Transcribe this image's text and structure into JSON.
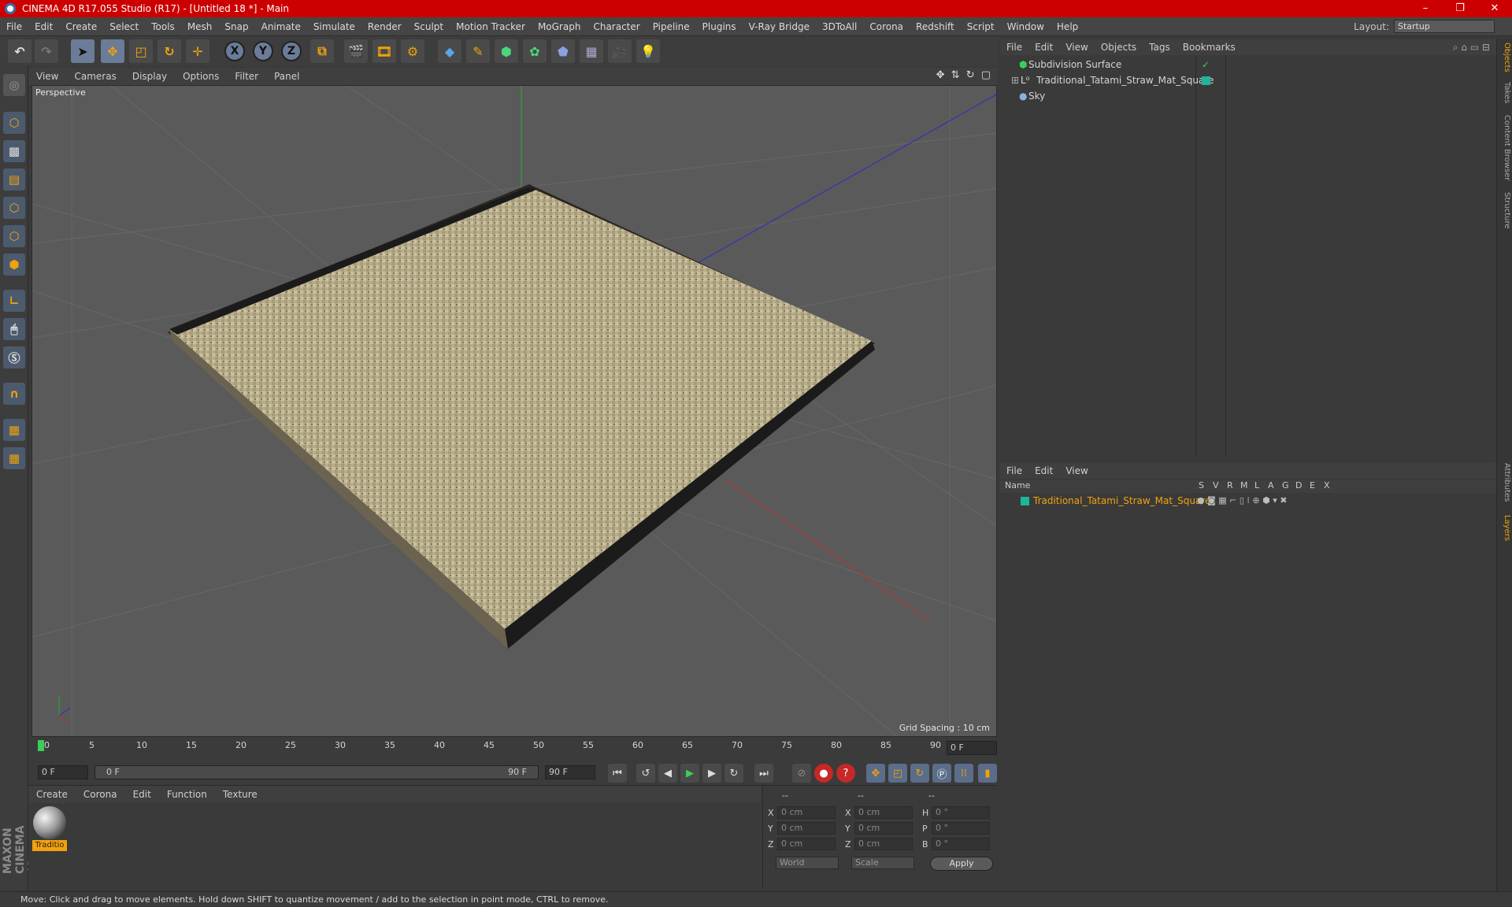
{
  "window": {
    "title": "CINEMA 4D R17.055 Studio (R17) - [Untitled 18 *] - Main",
    "controls": [
      "–",
      "❐",
      "✕"
    ]
  },
  "menubar": {
    "items": [
      "File",
      "Edit",
      "Create",
      "Select",
      "Tools",
      "Mesh",
      "Snap",
      "Animate",
      "Simulate",
      "Render",
      "Sculpt",
      "Motion Tracker",
      "MoGraph",
      "Character",
      "Pipeline",
      "Plugins",
      "V-Ray Bridge",
      "3DToAll",
      "Corona",
      "Redshift",
      "Script",
      "Window",
      "Help"
    ],
    "layout_label": "Layout:",
    "layout_value": "Startup"
  },
  "toolbar": {
    "axis_x": "X",
    "axis_y": "Y",
    "axis_z": "Z"
  },
  "viewport": {
    "menu": [
      "View",
      "Cameras",
      "Display",
      "Options",
      "Filter",
      "Panel"
    ],
    "label": "Perspective",
    "grid_spacing": "Grid Spacing : 10 cm",
    "nav_icons": "✥ ⇅ ↻ ▢"
  },
  "timeline": {
    "ticks": [
      "0",
      "5",
      "10",
      "15",
      "20",
      "25",
      "30",
      "35",
      "40",
      "45",
      "50",
      "55",
      "60",
      "65",
      "70",
      "75",
      "80",
      "85",
      "90"
    ],
    "current_frame": "0 F"
  },
  "transport": {
    "start_field": "0 F",
    "range_start": "0 F",
    "range_end": "90 F",
    "end_field": "90 F"
  },
  "material_manager": {
    "menu": [
      "Create",
      "Corona",
      "Edit",
      "Function",
      "Texture"
    ],
    "material_label": "Traditio"
  },
  "coordinates": {
    "header": [
      "--",
      "--",
      "--"
    ],
    "rows": [
      {
        "l1": "X",
        "v1": "0 cm",
        "l2": "X",
        "v2": "0 cm",
        "l3": "H",
        "v3": "0 °"
      },
      {
        "l1": "Y",
        "v1": "0 cm",
        "l2": "Y",
        "v2": "0 cm",
        "l3": "P",
        "v3": "0 °"
      },
      {
        "l1": "Z",
        "v1": "0 cm",
        "l2": "Z",
        "v2": "0 cm",
        "l3": "B",
        "v3": "0 °"
      }
    ],
    "world": "World",
    "scale": "Scale",
    "apply": "Apply"
  },
  "object_manager": {
    "menu": [
      "File",
      "Edit",
      "View",
      "Objects",
      "Tags",
      "Bookmarks"
    ],
    "objects": [
      "Subdivision Surface",
      "Traditional_Tatami_Straw_Mat_Square",
      "Sky"
    ]
  },
  "layer_manager": {
    "menu": [
      "File",
      "Edit",
      "View"
    ],
    "columns": [
      "Name",
      "S",
      "V",
      "R",
      "M",
      "L",
      "A",
      "G",
      "D",
      "E",
      "X"
    ],
    "layers": [
      "Traditional_Tatami_Straw_Mat_Square"
    ]
  },
  "side_tabs": [
    "Objects",
    "Takes",
    "Content Browser",
    "Structure",
    "Attributes",
    "Layers"
  ],
  "status": "Move: Click and drag to move elements. Hold down SHIFT to quantize movement / add to the selection in point mode, CTRL to remove.",
  "brand": "MAXON CINEMA 4D",
  "colors": {
    "titlebar": "#cc0000",
    "accent": "#f2a20c",
    "layer_color": "#1fb59a",
    "layer_text": "#f2a20c"
  }
}
